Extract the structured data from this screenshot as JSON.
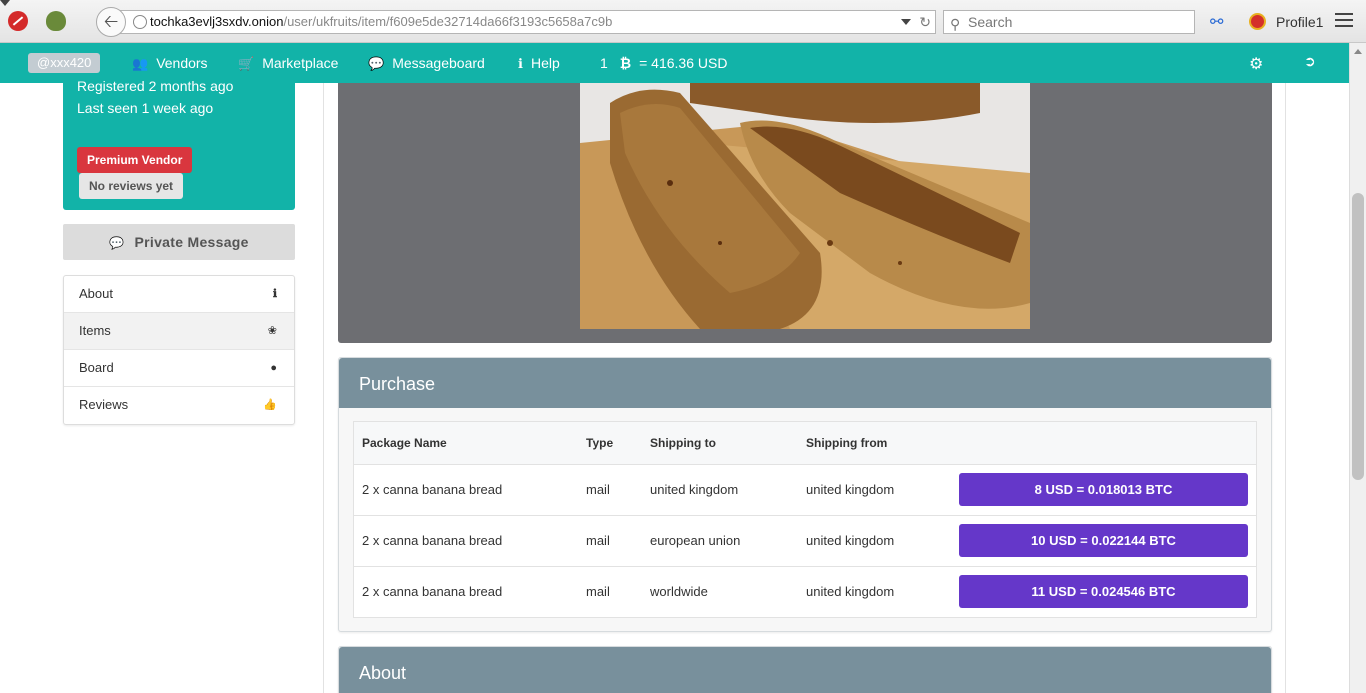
{
  "browser": {
    "url_host": "tochka3evlj3sxdv.onion",
    "url_path": "/user/ukfruits/item/f609e5de32714da66f3193c5658a7c9b",
    "search_placeholder": "Search",
    "profile_label": "Profile1"
  },
  "navbar": {
    "username": "@xxx420",
    "items": [
      {
        "label": "Vendors",
        "icon": "users-icon"
      },
      {
        "label": "Marketplace",
        "icon": "cart-icon"
      },
      {
        "label": "Messageboard",
        "icon": "comments-icon"
      },
      {
        "label": "Help",
        "icon": "info-icon"
      }
    ],
    "rate_prefix": "1",
    "rate_text": "= 416.36 USD",
    "accent_color": "#12b3a8"
  },
  "vendor": {
    "registered": "Registered 2 months ago",
    "last_seen": "Last seen 1 week ago",
    "premium_badge": "Premium Vendor",
    "reviews_badge": "No reviews yet"
  },
  "sidebar": {
    "private_message": "Private Message",
    "menu": [
      {
        "label": "About",
        "icon": "info-icon"
      },
      {
        "label": "Items",
        "icon": "leaf-icon"
      },
      {
        "label": "Board",
        "icon": "comment-icon"
      },
      {
        "label": "Reviews",
        "icon": "thumbs-up-icon"
      }
    ]
  },
  "purchase": {
    "title": "Purchase",
    "columns": [
      "Package Name",
      "Type",
      "Shipping to",
      "Shipping from"
    ],
    "rows": [
      {
        "package": "2 x canna banana bread",
        "type": "mail",
        "ship_to": "united kingdom",
        "ship_from": "united kingdom",
        "price": "8 USD = 0.018013 BTC"
      },
      {
        "package": "2 x canna banana bread",
        "type": "mail",
        "ship_to": "european union",
        "ship_from": "united kingdom",
        "price": "10 USD = 0.022144 BTC"
      },
      {
        "package": "2 x canna banana bread",
        "type": "mail",
        "ship_to": "worldwide",
        "ship_from": "united kingdom",
        "price": "11 USD = 0.024546 BTC"
      }
    ],
    "button_color": "#6537c9"
  },
  "about": {
    "title": "About"
  }
}
